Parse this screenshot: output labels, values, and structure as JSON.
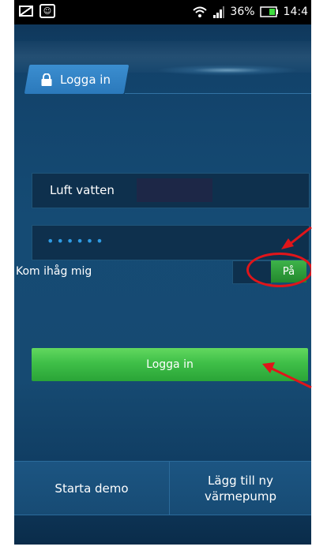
{
  "status_bar": {
    "battery_percent": "36%",
    "time": "14:4",
    "icons": [
      "sim-card-icon",
      "smiley-notification-icon",
      "wifi-icon",
      "signal-icon",
      "battery-icon"
    ]
  },
  "header": {
    "tab_label": "Logga in",
    "tab_icon": "lock-icon"
  },
  "form": {
    "username_value": "Luft vatten",
    "password_value": "••••••",
    "remember_label": "Kom ihåg mig",
    "remember_toggle_label": "På",
    "login_button_label": "Logga in"
  },
  "footer": {
    "demo_button_label": "Starta demo",
    "add_button_line1": "Lägg till ny",
    "add_button_line2": "värmepump"
  },
  "colors": {
    "background": "#154b74",
    "accent_blue": "#2b79bb",
    "green": "#3fbf48",
    "annotation_red": "#e0151a"
  }
}
